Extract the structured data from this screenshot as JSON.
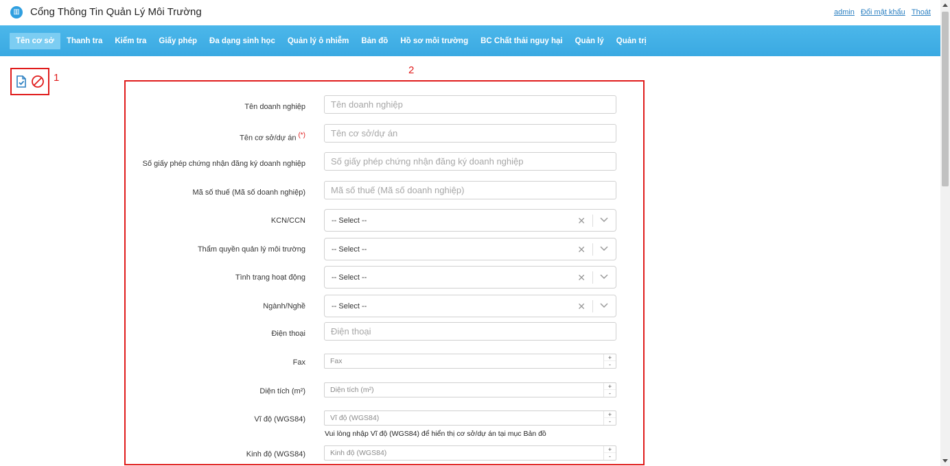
{
  "header": {
    "app_title": "Cổng Thông Tin Quản Lý Môi Trường",
    "user": "admin",
    "change_password": "Đổi mật khẩu",
    "logout": "Thoát"
  },
  "nav": {
    "items": [
      {
        "label": "Tên cơ sở",
        "active": true
      },
      {
        "label": "Thanh tra"
      },
      {
        "label": "Kiểm tra"
      },
      {
        "label": "Giấy phép"
      },
      {
        "label": "Đa dạng sinh học"
      },
      {
        "label": "Quản lý ô nhiễm"
      },
      {
        "label": "Bản đồ"
      },
      {
        "label": "Hồ sơ môi trường"
      },
      {
        "label": "BC Chất thải nguy hại"
      },
      {
        "label": "Quản lý"
      },
      {
        "label": "Quản trị"
      }
    ]
  },
  "markers": {
    "toolbar": "1",
    "form": "2"
  },
  "form": {
    "ten_doanh_nghiep": {
      "label": "Tên doanh nghiệp",
      "placeholder": "Tên doanh nghiệp"
    },
    "ten_co_so": {
      "label": "Tên cơ sở/dự án",
      "required_mark": "(*)",
      "placeholder": "Tên cơ sở/dự án"
    },
    "so_giay_phep": {
      "label": "Số giấy phép chứng nhận đăng ký doanh nghiệp",
      "placeholder": "Số giấy phép chứng nhận đăng ký doanh nghiệp"
    },
    "ma_so_thue": {
      "label": "Mã số thuế (Mã số doanh nghiệp)",
      "placeholder": "Mã số thuế (Mã số doanh nghiệp)"
    },
    "kcn_ccn": {
      "label": "KCN/CCN",
      "value": "-- Select --"
    },
    "tham_quyen": {
      "label": "Thẩm quyền quản lý môi trường",
      "value": "-- Select --"
    },
    "tinh_trang": {
      "label": "Tình trạng hoạt động",
      "value": "-- Select --"
    },
    "nganh_nghe": {
      "label": "Ngành/Nghề",
      "value": "-- Select --"
    },
    "dien_thoai": {
      "label": "Điện thoại",
      "placeholder": "Điện thoại"
    },
    "fax": {
      "label": "Fax",
      "placeholder": "Fax"
    },
    "dien_tich": {
      "label": "Diện tích (m²)",
      "placeholder": "Diện tích (m²)"
    },
    "vi_do": {
      "label": "Vĩ độ (WGS84)",
      "placeholder": "Vĩ độ (WGS84)",
      "help": "Vui lòng nhập Vĩ độ (WGS84) để hiển thị cơ sở/dự án tại mục Bản đồ"
    },
    "kinh_do": {
      "label": "Kinh độ (WGS84)",
      "placeholder": "Kinh độ (WGS84)"
    },
    "select_clear_glyph": "✕",
    "spin_up": "+",
    "spin_down": "-"
  },
  "colors": {
    "nav_bg": "#3aa9e2",
    "highlight_border": "#e01b1b",
    "icon_save": "#2a7fc1",
    "icon_cancel": "#e01b1b"
  }
}
